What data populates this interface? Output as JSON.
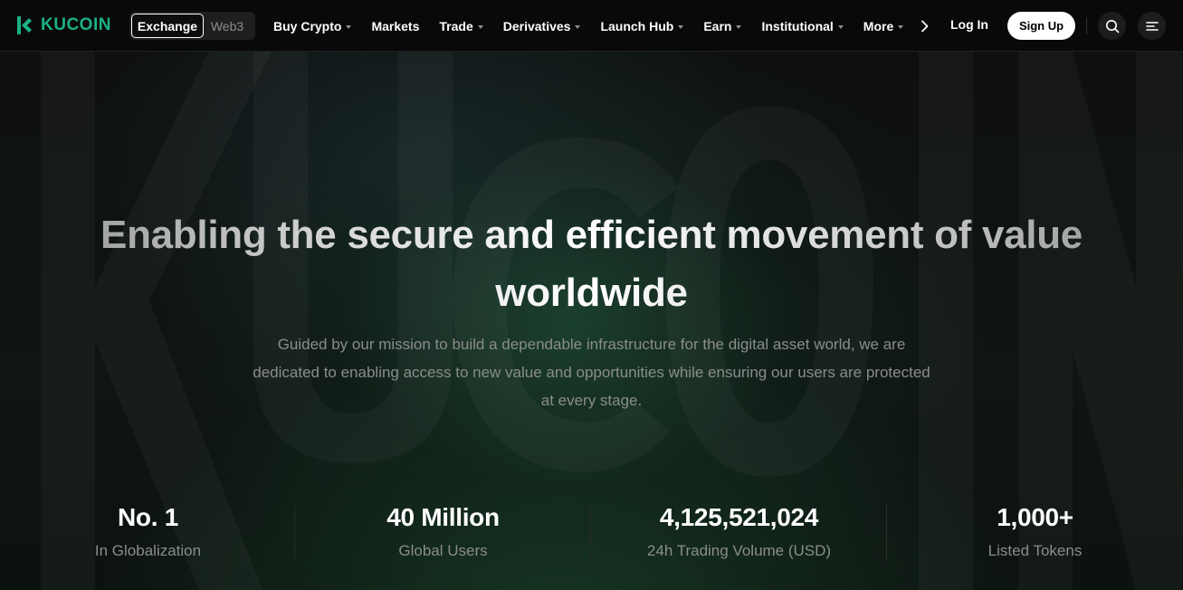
{
  "brand": {
    "name": "KUCOIN",
    "color": "#1bb185"
  },
  "mode_switch": {
    "active": "Exchange",
    "inactive": "Web3"
  },
  "menu": [
    {
      "label": "Buy Crypto",
      "dropdown": true
    },
    {
      "label": "Markets",
      "dropdown": false
    },
    {
      "label": "Trade",
      "dropdown": true
    },
    {
      "label": "Derivatives",
      "dropdown": true
    },
    {
      "label": "Launch Hub",
      "dropdown": true
    },
    {
      "label": "Earn",
      "dropdown": true
    },
    {
      "label": "Institutional",
      "dropdown": true
    },
    {
      "label": "More",
      "dropdown": true
    }
  ],
  "auth": {
    "login": "Log In",
    "signup": "Sign Up"
  },
  "icons": {
    "next": "chevron-right-icon",
    "search": "search-icon",
    "menu": "menu-icon"
  },
  "hero": {
    "headline_line1": "Enabling the secure and efficient movement of value",
    "headline_line2": "worldwide",
    "subtext": "Guided by our mission to build a dependable infrastructure for the digital asset world, we are dedicated to enabling access to new value and opportunities while ensuring our users are protected at every stage."
  },
  "stats": [
    {
      "value": "No. 1",
      "label": "In Globalization"
    },
    {
      "value": "40 Million",
      "label": "Global Users"
    },
    {
      "value": "4,125,521,024",
      "label": "24h Trading Volume (USD)"
    },
    {
      "value": "1,000+",
      "label": "Listed Tokens"
    }
  ]
}
